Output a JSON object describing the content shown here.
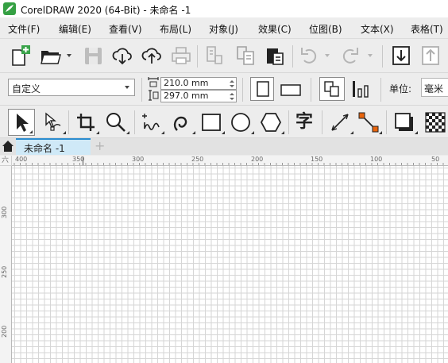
{
  "window": {
    "title": "CorelDRAW 2020 (64-Bit) - 未命名 -1"
  },
  "menu": [
    {
      "label": "文件(F)"
    },
    {
      "label": "编辑(E)"
    },
    {
      "label": "查看(V)"
    },
    {
      "label": "布局(L)"
    },
    {
      "label": "对象(J)"
    },
    {
      "label": "效果(C)"
    },
    {
      "label": "位图(B)"
    },
    {
      "label": "文本(X)"
    },
    {
      "label": "表格(T)"
    }
  ],
  "property_bar": {
    "page_size": "自定义",
    "width": "210.0 mm",
    "height": "297.0 mm",
    "unit_label": "单位:",
    "unit_value": "毫米"
  },
  "toolbox": {
    "text_tool_glyph": "字"
  },
  "tabs": {
    "document_tab": "未命名 -1",
    "add_tab_glyph": "+"
  },
  "rulers": {
    "horizontal_ticks": [
      "400",
      "350",
      "300",
      "250",
      "200",
      "150",
      "100",
      "50"
    ],
    "vertical_ticks": [
      "300",
      "250",
      "200"
    ],
    "corner_mark": "六"
  },
  "colors": {
    "accent": "#2b8ccf",
    "active_tab_bg": "#cfe9f7",
    "node_orange": "#e8640c",
    "title_icon_green": "#35a043"
  }
}
